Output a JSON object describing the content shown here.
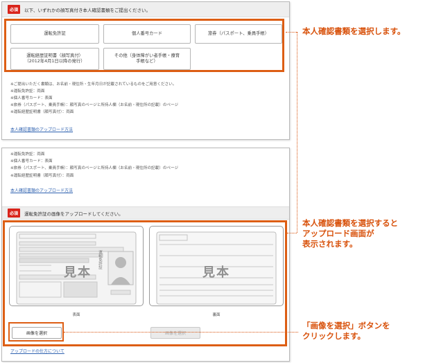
{
  "panel1": {
    "required_badge": "必須",
    "instruction": "以下、いずれかの顔写真付き本人確認書類をご提出ください。",
    "doc_buttons": [
      "運転免許証",
      "個人番号カード",
      "旅券（パスポート、乗員手帳）",
      "運転経歴証明書（顔写真付）\n（2012年4月1日以降の発行）",
      "その他（身体障がい者手帳・療育\n手帳など）"
    ],
    "notes": [
      "※ご提出いただく書類は、お名前・現住所・生年月日が記載されているものをご用意ください。",
      "※運転免許証：両面",
      "※個人番号カード：表面",
      "※旅券（パスポート、乗員手帳）：顔写真のページと所持人欄（お名前・現住所の記載）のページ",
      "※運転経歴証明書（顔写真付）：両面"
    ],
    "upload_link": "本人確認書類のアップロード方法"
  },
  "panel2": {
    "notes": [
      "※運転免許証：両面",
      "※個人番号カード：表面",
      "※旅券（パスポート、乗員手帳）：顔写真のページと所持人欄（お名前・現住所の記載）のページ",
      "※運転経歴証明書（顔写真付）：両面"
    ],
    "upload_link": "本人確認書類のアップロード方法",
    "required_badge": "必須",
    "upload_heading": "運転免許証の画像をアップロードしてください。",
    "front_caption": "表面",
    "back_caption": "裏面",
    "sample_text": "見本",
    "license_vertical": "運転免許証",
    "select_button": "画像を選択",
    "select_button_disabled": "画像を選択",
    "howto_link": "アップロードの仕方について"
  },
  "annotations": {
    "a1": "本人確認書類を選択します。",
    "a2": "本人確認書類を選択すると\nアップロード画面が\n表示されます。",
    "a3": "「画像を選択」ボタンを\nクリックします。"
  },
  "colors": {
    "accent": "#dd5e14",
    "badge": "#d9241b",
    "link": "#2f62b0"
  }
}
